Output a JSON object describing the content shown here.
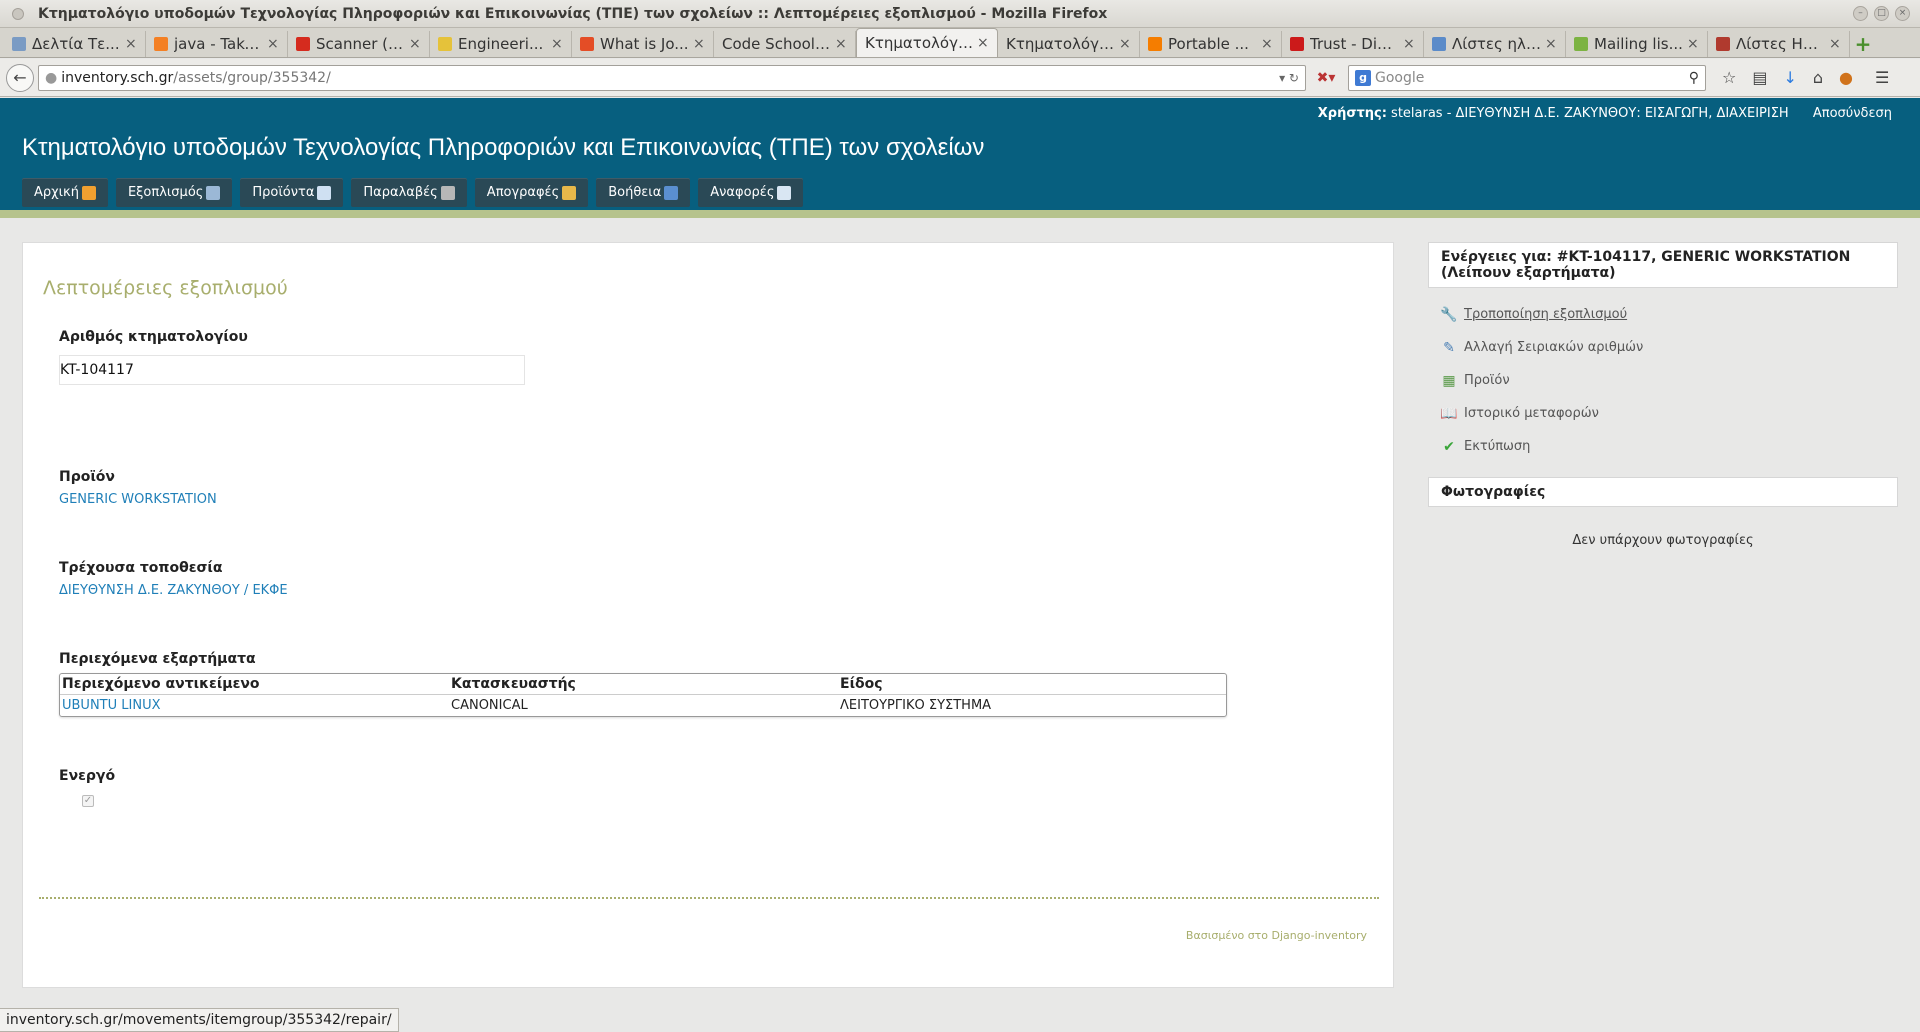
{
  "window": {
    "title": "Κτηματολόγιο υποδομών Τεχνολογίας Πληροφοριών και Επικοινωνίας (ΤΠΕ) των σχολείων :: Λεπτομέρειες εξοπλισμού - Mozilla Firefox"
  },
  "tabs": [
    {
      "label": "Δελτία Τε...",
      "icon": "globe-icon",
      "color": "#7a9bc4"
    },
    {
      "label": "java - Take...",
      "icon": "stackoverflow-icon",
      "color": "#f48024"
    },
    {
      "label": "Scanner (J...",
      "icon": "oracle-icon",
      "color": "#d52b1e"
    },
    {
      "label": "Engineeri...",
      "icon": "page-icon",
      "color": "#e5c23a"
    },
    {
      "label": "What is Jo...",
      "icon": "joomla-icon",
      "color": "#e44d26"
    },
    {
      "label": "Code School -...",
      "icon": "none",
      "color": ""
    },
    {
      "label": "Κτηματολόγι...",
      "icon": "none",
      "color": "",
      "active": true
    },
    {
      "label": "Κτηματολόγι...",
      "icon": "none",
      "color": ""
    },
    {
      "label": "Portable ...",
      "icon": "blogger-icon",
      "color": "#f57d00"
    },
    {
      "label": "Trust - Dig...",
      "icon": "cross-icon",
      "color": "#cc1a1a"
    },
    {
      "label": "Λίστες ηλε...",
      "icon": "lists-icon",
      "color": "#5b8bc9"
    },
    {
      "label": "Mailing lis...",
      "icon": "mailing-icon",
      "color": "#7cb342"
    },
    {
      "label": "Λίστες Ηλ...",
      "icon": "library-icon",
      "color": "#b03a2e"
    }
  ],
  "navbar": {
    "url_host": "inventory.sch.gr",
    "url_path": "/assets/group/355342/",
    "search_placeholder": "Google"
  },
  "header": {
    "user_label": "Χρήστης:",
    "user_value": "stelaras - ΔΙΕΥΘΥΝΣΗ Δ.Ε. ΖΑΚΥΝΘΟΥ: ΕΙΣΑΓΩΓΗ, ΔΙΑΧΕΙΡΙΣΗ",
    "logout": "Αποσύνδεση",
    "site_title": "Κτηματολόγιο υποδομών Τεχνολογίας Πληροφοριών και Επικοινωνίας (ΤΠΕ) των σχολείων",
    "menu": [
      {
        "label": "Αρχική",
        "icon": "home-icon",
        "color": "#f0a030"
      },
      {
        "label": "Εξοπλισμός",
        "icon": "equipment-icon",
        "color": "#9bb8d6"
      },
      {
        "label": "Προϊόντα",
        "icon": "document-icon",
        "color": "#cfe0f2"
      },
      {
        "label": "Παραλαβές",
        "icon": "truck-icon",
        "color": "#b7b7b7"
      },
      {
        "label": "Απογραφές",
        "icon": "box-icon",
        "color": "#e8b84a"
      },
      {
        "label": "Βοήθεια",
        "icon": "help-icon",
        "color": "#5a8fd0"
      },
      {
        "label": "Αναφορές",
        "icon": "report-icon",
        "color": "#d9e6f3"
      }
    ]
  },
  "main": {
    "heading": "Λεπτομέρειες εξοπλισμού",
    "registry_label": "Αριθμός κτηματολογίου",
    "registry_value": "KT-104117",
    "product_label": "Προϊόν",
    "product_value": "GENERIC WORKSTATION",
    "location_label": "Τρέχουσα τοποθεσία",
    "location_value": "ΔΙΕΥΘΥΝΣΗ Δ.Ε. ΖΑΚΥΝΘΟΥ / ΕΚΦΕ",
    "parts_label": "Περιεχόμενα εξαρτήματα",
    "parts_table": {
      "headers": [
        "Περιεχόμενο αντικείμενο",
        "Κατασκευαστής",
        "Είδος"
      ],
      "rows": [
        [
          "UBUNTU LINUX",
          "CANONICAL",
          "ΛΕΙΤΟΥΡΓΙΚΟ ΣΥΣΤΗΜΑ"
        ]
      ]
    },
    "active_label": "Ενεργό",
    "active_checked": true,
    "footer": "Βασισμένο στο Django-inventory"
  },
  "sidebar": {
    "actions_title": "Ενέργειες για: #KT-104117, GENERIC WORKSTATION (Λείπουν εξαρτήματα)",
    "actions": [
      {
        "label": "Τροποποίηση εξοπλισμού",
        "icon": "wrench-icon",
        "hover": true
      },
      {
        "label": "Αλλαγή Σειριακών αριθμών",
        "icon": "edit-serials-icon"
      },
      {
        "label": "Προϊόν",
        "icon": "product-icon"
      },
      {
        "label": "Ιστορικό μεταφορών",
        "icon": "book-icon"
      },
      {
        "label": "Εκτύπωση",
        "icon": "check-icon"
      }
    ],
    "photos_title": "Φωτογραφίες",
    "photos_empty": "Δεν υπάρχουν φωτογραφίες"
  },
  "statusbar": {
    "text": "inventory.sch.gr/movements/itemgroup/355342/repair/"
  }
}
